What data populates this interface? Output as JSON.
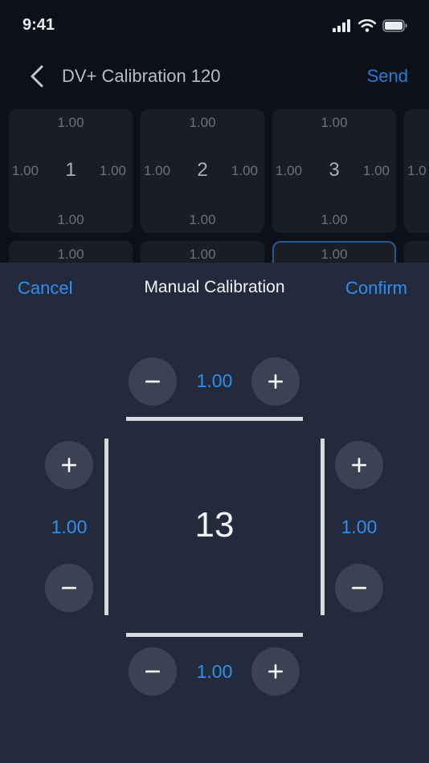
{
  "status_bar": {
    "time": "9:41",
    "icons": [
      "signal-icon",
      "wifi-icon",
      "battery-icon"
    ]
  },
  "nav": {
    "title": "DV+ Calibration 120",
    "send_label": "Send"
  },
  "grid": {
    "cells": [
      {
        "number": "1",
        "top": "1.00",
        "bottom": "1.00",
        "left": "1.00",
        "right": "1.00"
      },
      {
        "number": "2",
        "top": "1.00",
        "bottom": "1.00",
        "left": "1.00",
        "right": "1.00"
      },
      {
        "number": "3",
        "top": "1.00",
        "bottom": "1.00",
        "left": "1.00",
        "right": "1.00"
      },
      {
        "number": "",
        "top": "",
        "bottom": "",
        "left": "1.0",
        "right": ""
      },
      {
        "top": "1.00"
      },
      {
        "top": "1.00"
      },
      {
        "top": "1.00"
      }
    ]
  },
  "sheet": {
    "cancel_label": "Cancel",
    "title": "Manual Calibration",
    "confirm_label": "Confirm",
    "cell_number": "13",
    "top_value": "1.00",
    "bottom_value": "1.00",
    "left_value": "1.00",
    "right_value": "1.00"
  },
  "colors": {
    "accent": "#2d8ff0",
    "sheet_bg": "#232a3b",
    "button_bg": "#3b4254"
  }
}
